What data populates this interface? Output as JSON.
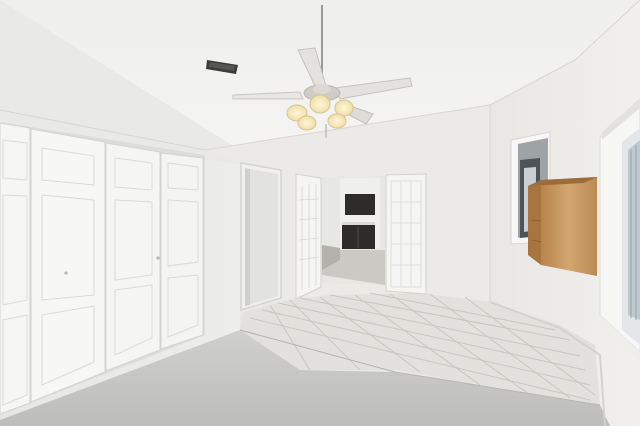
{
  "scene": {
    "type": "photo",
    "subject": "empty-bedroom",
    "colors": {
      "wall": "#ecebe8",
      "wall_shadow": "#dcdbd8",
      "ceiling": "#f1f1ef",
      "carpet": "#c6c6c4",
      "tile": "#e2e0dc",
      "grout": "#c9c7c2",
      "door_white": "#f6f6f4",
      "door_trim": "#d9d9d6",
      "shelf_wood": "#c99a62",
      "shelf_dark": "#9b6d3b",
      "kitchen_cabinet": "#2e2c2b",
      "window_glass": "#dfe6ea",
      "fan_blade": "#e4e2df",
      "fan_light": "#f3e2b5"
    },
    "icons": {
      "fan": "ceiling-fan-icon",
      "vent": "air-vent-icon"
    }
  }
}
